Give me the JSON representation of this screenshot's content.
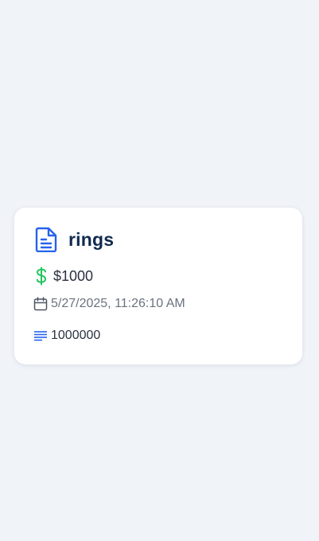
{
  "item": {
    "name": "rings",
    "price": "$1000",
    "date": "5/27/2025, 11:26:10 AM",
    "quantity": "1000000"
  },
  "icons": {
    "document": "document-icon",
    "price": "dollar-icon",
    "date": "calendar-icon",
    "quantity": "lines-icon"
  },
  "colors": {
    "background": "#f0f3f8",
    "card": "#ffffff",
    "title": "#0f2a4f",
    "document_icon": "#2563eb",
    "dollar_icon": "#22c55e",
    "muted_text": "#6b7280",
    "body_text": "#2a3240"
  }
}
